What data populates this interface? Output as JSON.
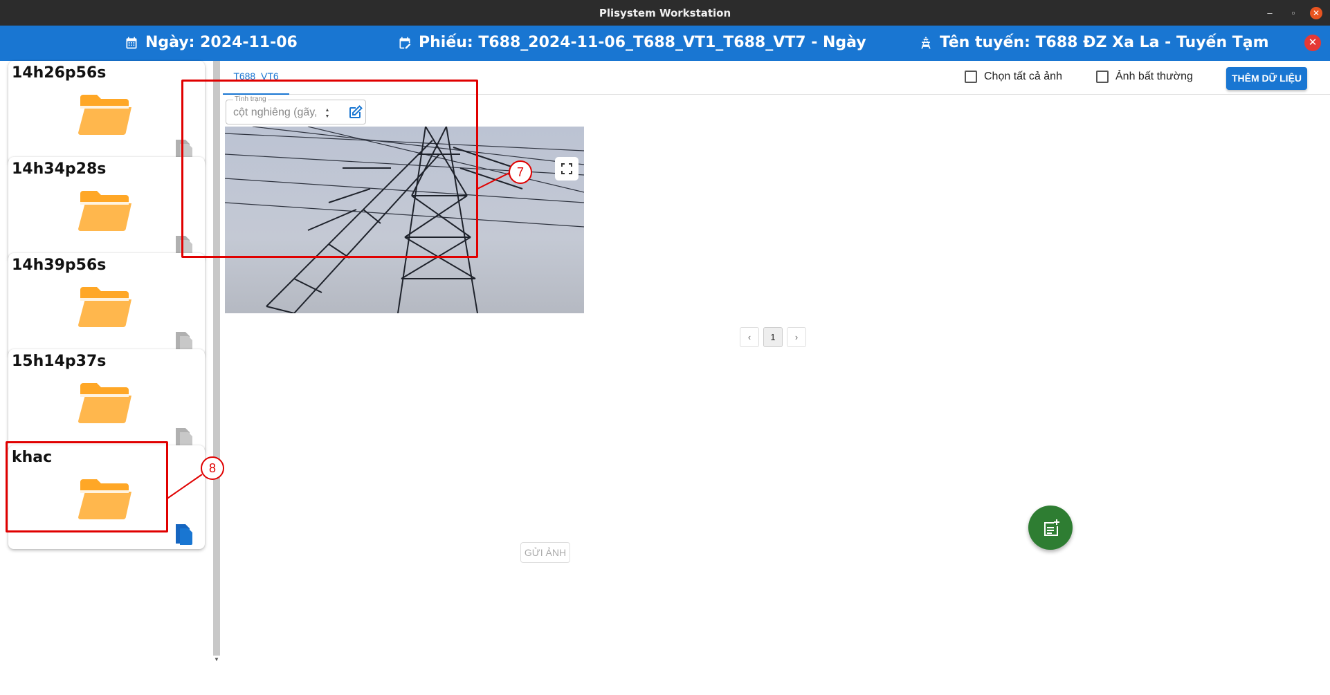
{
  "window": {
    "title": "Plisystem Workstation"
  },
  "header": {
    "date": "Ngày: 2024-11-06",
    "ticket": "Phiếu: T688_2024-11-06_T688_VT1_T688_VT7 - Ngày",
    "route": "Tên tuyến: T688 ĐZ Xa La - Tuyến Tạm"
  },
  "sidebar": {
    "folders": [
      {
        "name": "14h26p56s"
      },
      {
        "name": "14h34p28s"
      },
      {
        "name": "14h39p56s"
      },
      {
        "name": "15h14p37s"
      },
      {
        "name": "khac"
      }
    ]
  },
  "tabs": [
    {
      "label": "T688_VT6",
      "active": true
    }
  ],
  "toolbar": {
    "select_all_label": "Chọn tất cả ảnh",
    "abnormal_label": "Ảnh bất thường",
    "add_data_label": "THÊM DỮ LIỆU"
  },
  "image_card": {
    "status_legend": "Tình trạng",
    "status_value": "cột nghiêng (gãy,"
  },
  "pagination": {
    "prev": "‹",
    "current": "1",
    "next": "›"
  },
  "footer": {
    "send_label": "GỬI ẢNH"
  },
  "annotations": {
    "image_marker": "7",
    "folder_marker": "8"
  },
  "colors": {
    "primary": "#1976d2",
    "folder": "#ffa726",
    "annotation": "#e00000",
    "fab": "#2e7d32"
  },
  "icons": {
    "date": "calendar-icon",
    "ticket": "calendar-edit-icon",
    "route": "tower-icon",
    "folder": "folder-open-icon",
    "copy": "copy-icon",
    "edit": "edit-icon",
    "fullscreen": "fullscreen-icon",
    "fab": "note-add-icon"
  }
}
